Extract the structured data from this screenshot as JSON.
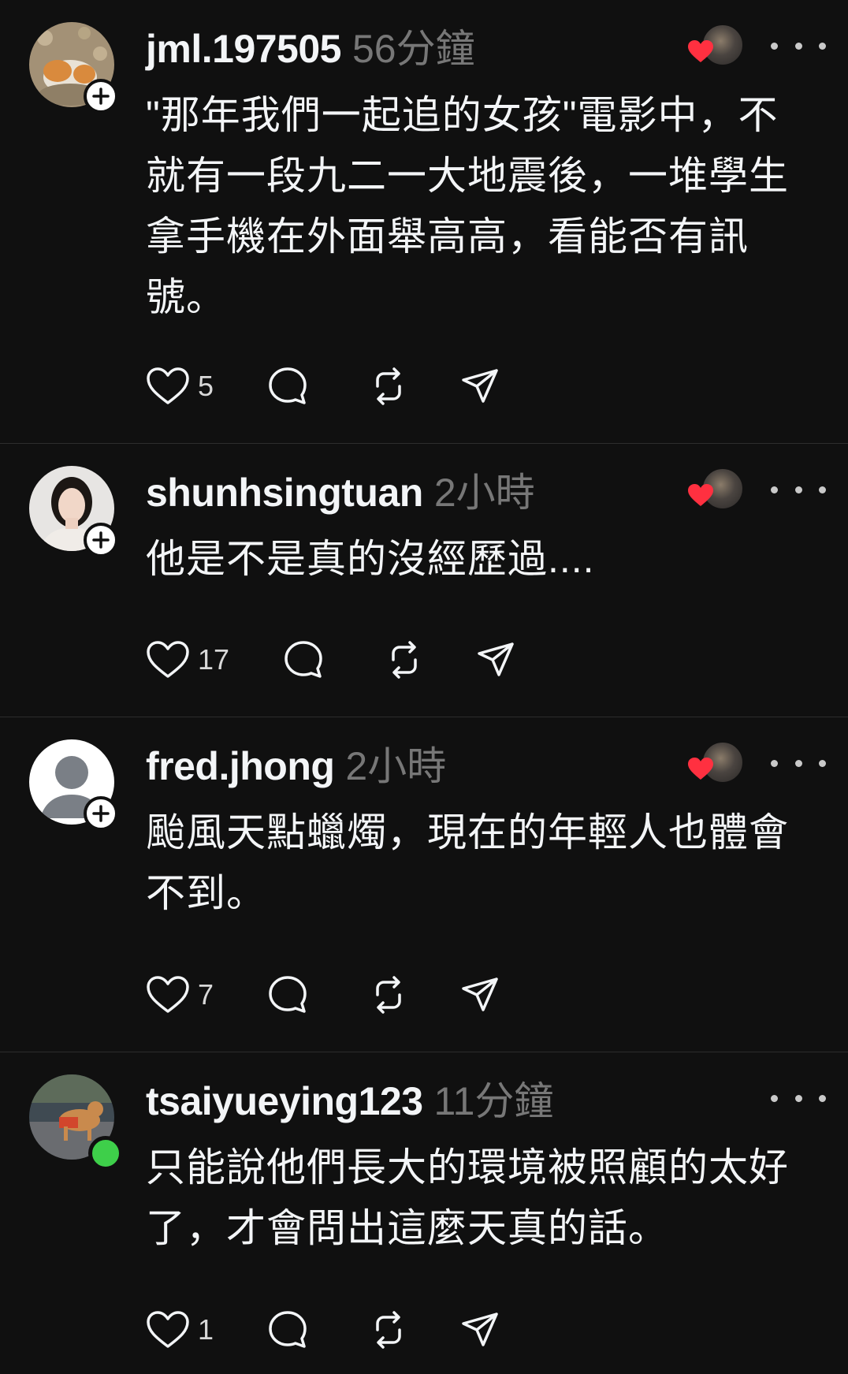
{
  "posts": [
    {
      "username": "jml.197505",
      "time": "56分鐘",
      "text": "\"那年我們一起追的女孩\"電影中，不就有一段九二一大地震後，一堆學生拿手機在外面舉高高，看能否有訊號。",
      "likes": "5",
      "badge": "follow"
    },
    {
      "username": "shunhsingtuan",
      "time": "2小時",
      "text": "他是不是真的沒經歷過....",
      "likes": "17",
      "badge": "follow"
    },
    {
      "username": "fred.jhong",
      "time": "2小時",
      "text": "颱風天點蠟燭，現在的年輕人也體會不到。",
      "likes": "7",
      "badge": "follow"
    },
    {
      "username": "tsaiyueying123",
      "time": "11分鐘",
      "text": "只能說他們長大的環境被照顧的太好了，才會問出這麼天真的話。",
      "likes": "1",
      "badge": "online"
    }
  ],
  "colors": {
    "background": "#101010",
    "text": "#f3f5f7",
    "muted": "#777777",
    "heart": "#ff3040",
    "online": "#3ecf4a"
  },
  "icons": {
    "like": "heart-outline-icon",
    "reply": "comment-bubble-icon",
    "repost": "repost-icon",
    "share": "send-paper-plane-icon",
    "more": "ellipsis-icon"
  }
}
